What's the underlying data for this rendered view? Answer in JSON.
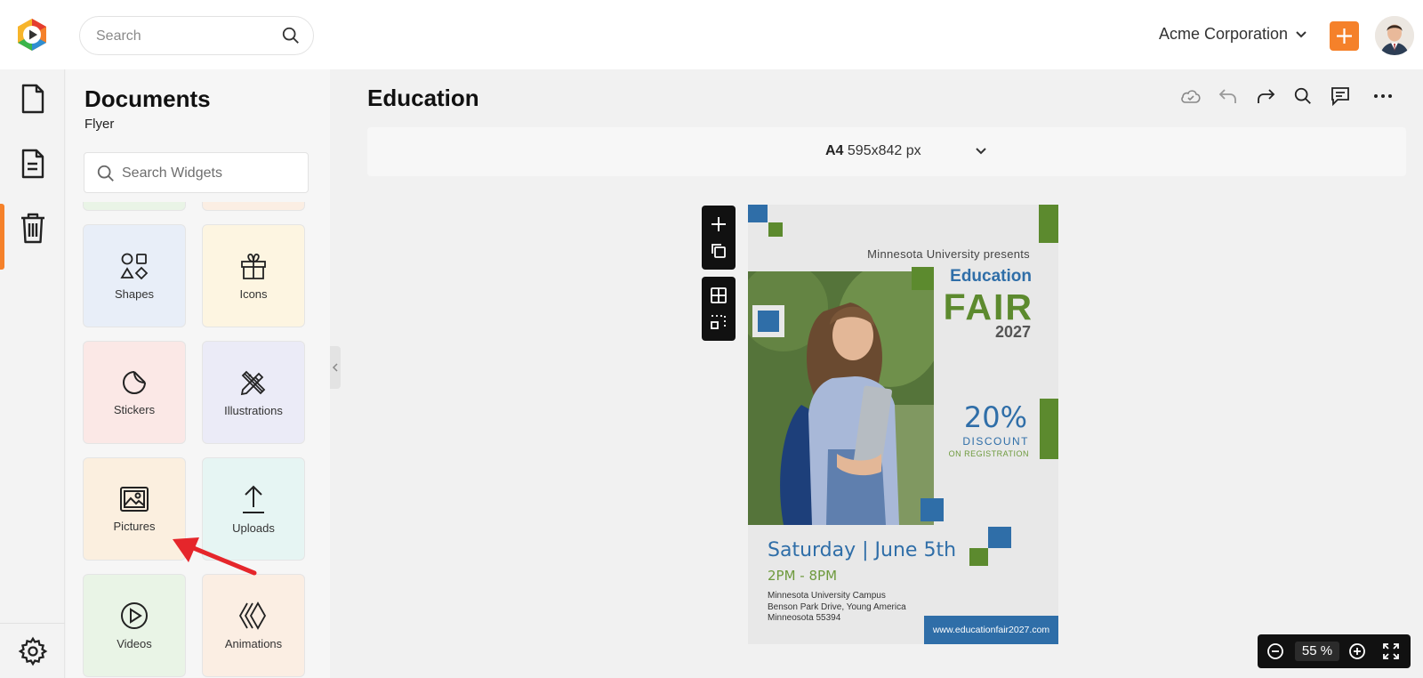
{
  "header": {
    "search_placeholder": "Search",
    "organization": "Acme Corporation"
  },
  "rail": {
    "items": [
      "document-icon",
      "flyer-document-icon",
      "trash-icon"
    ],
    "bottom": "settings-icon"
  },
  "panel": {
    "title": "Documents",
    "subtitle": "Flyer",
    "search_placeholder": "Search Widgets",
    "tiles": [
      {
        "label": "Shapes",
        "icon": "shapes-icon",
        "color": "#e8eef8"
      },
      {
        "label": "Icons",
        "icon": "gift-icon",
        "color": "#fdf5e1"
      },
      {
        "label": "Stickers",
        "icon": "sticker-icon",
        "color": "#fbe8e6"
      },
      {
        "label": "Illustrations",
        "icon": "pen-ruler-icon",
        "color": "#ebebf7"
      },
      {
        "label": "Pictures",
        "icon": "image-icon",
        "color": "#fbefdf"
      },
      {
        "label": "Uploads",
        "icon": "upload-icon",
        "color": "#e6f5f3"
      },
      {
        "label": "Videos",
        "icon": "play-icon",
        "color": "#e9f4e6"
      },
      {
        "label": "Animations",
        "icon": "animation-icon",
        "color": "#fbeee3"
      }
    ]
  },
  "editor": {
    "title": "Education",
    "page_size_name": "A4",
    "page_size_dims": "595x842 px",
    "zoom_value": "55",
    "zoom_unit": "%"
  },
  "flyer": {
    "presents": "Minnesota University presents",
    "headline1": "Education",
    "headline2": "FAIR",
    "year": "2027",
    "discount_pct": "20%",
    "discount_word": "DISCOUNT",
    "discount_note": "ON REGISTRATION",
    "date": "Saturday | June 5th",
    "time": "2PM - 8PM",
    "address_line1": "Minnesota University Campus",
    "address_line2": "Benson Park Drive, Young America",
    "address_line3": "Minneosota 55394",
    "url": "www.educationfair2027.com"
  },
  "colors": {
    "accent": "#f5812a",
    "flyer_blue": "#2f6ea8",
    "flyer_green": "#5c8a2e",
    "annotation_arrow": "#e5262b"
  }
}
